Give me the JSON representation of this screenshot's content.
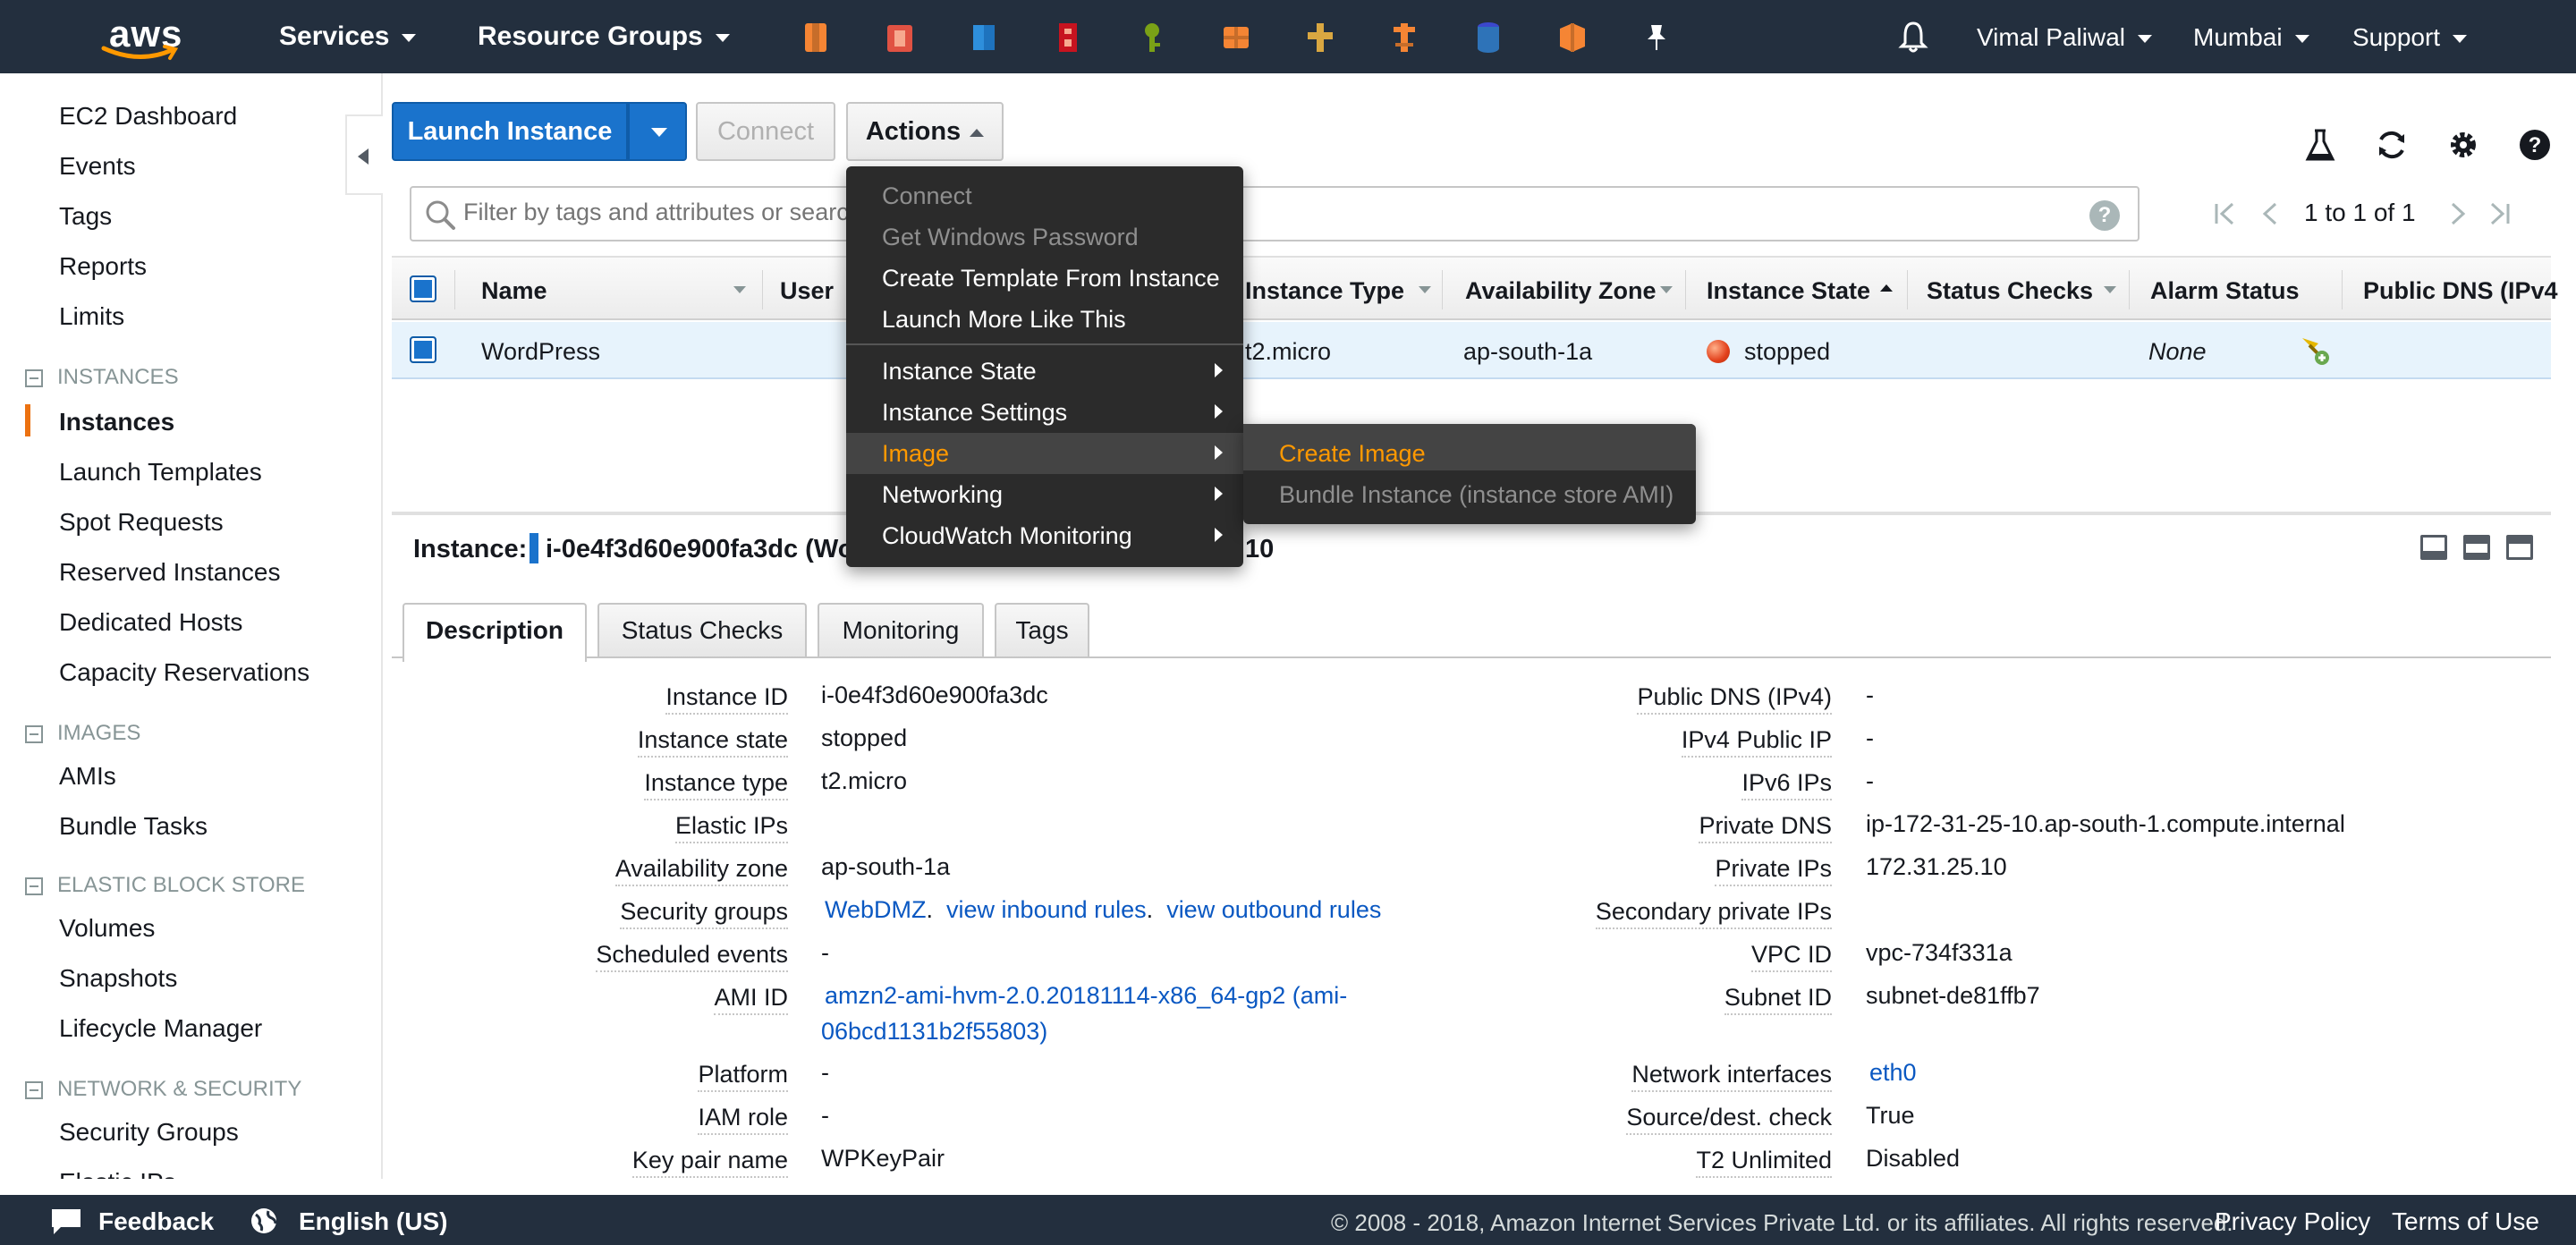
{
  "topnav": {
    "logo_text": "aws",
    "services": "Services",
    "resource_groups": "Resource Groups",
    "service_icons": [
      "ec2-icon",
      "cloudformation-icon",
      "s3-icon",
      "iam-icon",
      "kms-icon",
      "api-gateway-icon",
      "step-functions-icon",
      "lambda-icon",
      "rds-icon",
      "elastic-beanstalk-icon",
      "pin-icon"
    ],
    "user": "Vimal Paliwal",
    "region": "Mumbai",
    "support": "Support"
  },
  "sidebar": {
    "links_top": [
      "EC2 Dashboard",
      "Events",
      "Tags",
      "Reports",
      "Limits"
    ],
    "sections": [
      {
        "title": "INSTANCES",
        "items": [
          "Instances",
          "Launch Templates",
          "Spot Requests",
          "Reserved Instances",
          "Dedicated Hosts",
          "Capacity Reservations"
        ]
      },
      {
        "title": "IMAGES",
        "items": [
          "AMIs",
          "Bundle Tasks"
        ]
      },
      {
        "title": "ELASTIC BLOCK STORE",
        "items": [
          "Volumes",
          "Snapshots",
          "Lifecycle Manager"
        ]
      },
      {
        "title": "NETWORK & SECURITY",
        "items": [
          "Security Groups",
          "Elastic IPs"
        ]
      }
    ],
    "active_item": "Instances"
  },
  "toolbar": {
    "launch": "Launch Instance",
    "connect": "Connect",
    "actions": "Actions"
  },
  "filter": {
    "placeholder": "Filter by tags and attributes or search by keyword",
    "pager_text": "1 to 1 of 1"
  },
  "table": {
    "columns": [
      "Name",
      "User",
      "Instance Type",
      "Availability Zone",
      "Instance State",
      "Status Checks",
      "Alarm Status",
      "Public DNS (IPv4"
    ],
    "row": {
      "name": "WordPress",
      "instance_type": "t2.micro",
      "availability_zone": "ap-south-1a",
      "instance_state": "stopped",
      "alarm_status": "None"
    }
  },
  "instance_header": {
    "label": "Instance:",
    "id": "i-0e4f3d60e900fa3dc (Wo",
    "trailing": "10"
  },
  "tabs": [
    "Description",
    "Status Checks",
    "Monitoring",
    "Tags"
  ],
  "details_left": [
    {
      "label": "Instance ID",
      "value": "i-0e4f3d60e900fa3dc"
    },
    {
      "label": "Instance state",
      "value": "stopped"
    },
    {
      "label": "Instance type",
      "value": "t2.micro"
    },
    {
      "label": "Elastic IPs",
      "value": ""
    },
    {
      "label": "Availability zone",
      "value": "ap-south-1a"
    },
    {
      "label": "Security groups",
      "value": ""
    },
    {
      "label": "Scheduled events",
      "value": "-"
    },
    {
      "label": "AMI ID",
      "value": ""
    },
    {
      "label": "Platform",
      "value": "-"
    },
    {
      "label": "IAM role",
      "value": "-"
    },
    {
      "label": "Key pair name",
      "value": "WPKeyPair"
    }
  ],
  "security_groups": {
    "group": "WebDMZ",
    "inbound": "view inbound rules",
    "outbound": "view outbound rules"
  },
  "ami": {
    "line1": "amzn2-ami-hvm-2.0.20181114-x86_64-gp2 (ami-",
    "line2": "06bcd1131b2f55803)"
  },
  "details_right": [
    {
      "label": "Public DNS (IPv4)",
      "value": "-"
    },
    {
      "label": "IPv4 Public IP",
      "value": "-"
    },
    {
      "label": "IPv6 IPs",
      "value": "-"
    },
    {
      "label": "Private DNS",
      "value": "ip-172-31-25-10.ap-south-1.compute.internal"
    },
    {
      "label": "Private IPs",
      "value": "172.31.25.10"
    },
    {
      "label": "Secondary private IPs",
      "value": ""
    },
    {
      "label": "VPC ID",
      "value": "vpc-734f331a"
    },
    {
      "label": "Subnet ID",
      "value": "subnet-de81ffb7"
    },
    {
      "label": "Network interfaces",
      "value": "eth0"
    },
    {
      "label": "Source/dest. check",
      "value": "True"
    },
    {
      "label": "T2 Unlimited",
      "value": "Disabled"
    }
  ],
  "actions_menu": {
    "items": [
      "Connect",
      "Get Windows Password",
      "Create Template From Instance",
      "Launch More Like This",
      "Instance State",
      "Instance Settings",
      "Image",
      "Networking",
      "CloudWatch Monitoring"
    ],
    "submenu": [
      "Create Image",
      "Bundle Instance (instance store AMI)"
    ]
  },
  "footer": {
    "feedback": "Feedback",
    "language": "English (US)",
    "copyright": "© 2008 - 2018, Amazon Internet Services Private Ltd. or its affiliates. All rights reserved.",
    "privacy": "Privacy Policy",
    "terms": "Terms of Use"
  },
  "colors": {
    "nav_bg": "#232f3e",
    "primary": "#1a73cc",
    "accent": "#ec7211",
    "menu_bg": "#2b2b2b",
    "menu_highlight": "#ff9900",
    "link": "#0a58c2"
  }
}
